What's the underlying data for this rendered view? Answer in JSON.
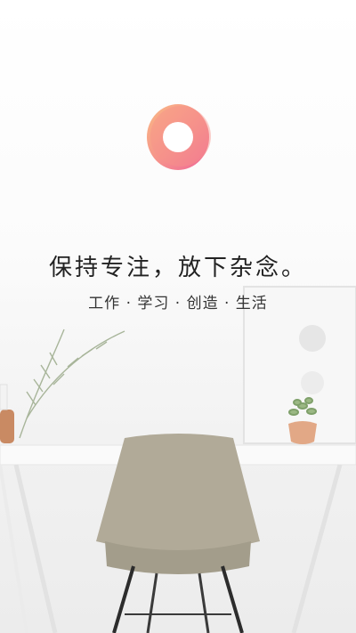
{
  "splash": {
    "logo": "tide-ring-logo",
    "tagline": "保持专注，放下杂念。",
    "subtitle": "工作 · 学习 · 创造 · 生活"
  },
  "colors": {
    "logo_outer": "#f7a27a",
    "logo_inner": "#f06292",
    "text": "#222222"
  }
}
